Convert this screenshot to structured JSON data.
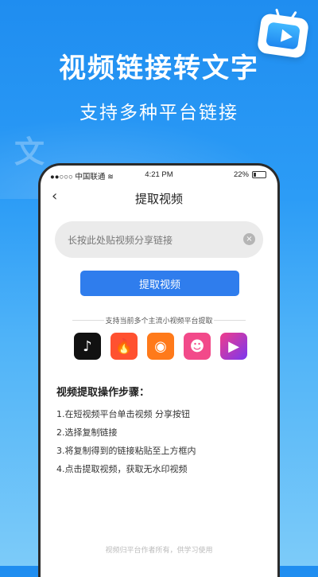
{
  "hero": {
    "title": "视频链接转文字",
    "subtitle": "支持多种平台链接",
    "decor_glyph": "文"
  },
  "status_bar": {
    "carrier": "●●○○○ 中国联通",
    "wifi_icon": "wifi-icon",
    "time": "4:21 PM",
    "battery": "22%"
  },
  "nav": {
    "back_icon": "‹",
    "title": "提取视频"
  },
  "input": {
    "placeholder": "长按此处贴视频分享链接",
    "value": "",
    "clear_icon": "×"
  },
  "extract_button": {
    "label": "提取视频"
  },
  "platforms": {
    "caption": "支持当前多个主流小视频平台提取",
    "items": [
      {
        "name": "tiktok-icon",
        "glyph": "♪"
      },
      {
        "name": "huoshan-icon",
        "glyph": "🔥"
      },
      {
        "name": "kuaishou-icon",
        "glyph": "◉"
      },
      {
        "name": "pipi-icon",
        "glyph": "☻"
      },
      {
        "name": "video-play-icon",
        "glyph": "▶"
      }
    ]
  },
  "steps": {
    "title": "视频提取操作步骤：",
    "items": [
      "1.在短视频平台单击视频 分享按钮",
      "2.选择复制链接",
      "3.将复制得到的链接粘贴至上方框内",
      "4.点击提取视频，获取无水印视频"
    ]
  },
  "footer": {
    "note": "视频归平台作者所有，供学习使用"
  },
  "colors": {
    "accent": "#2f7ded",
    "background_top": "#1f8df0"
  }
}
